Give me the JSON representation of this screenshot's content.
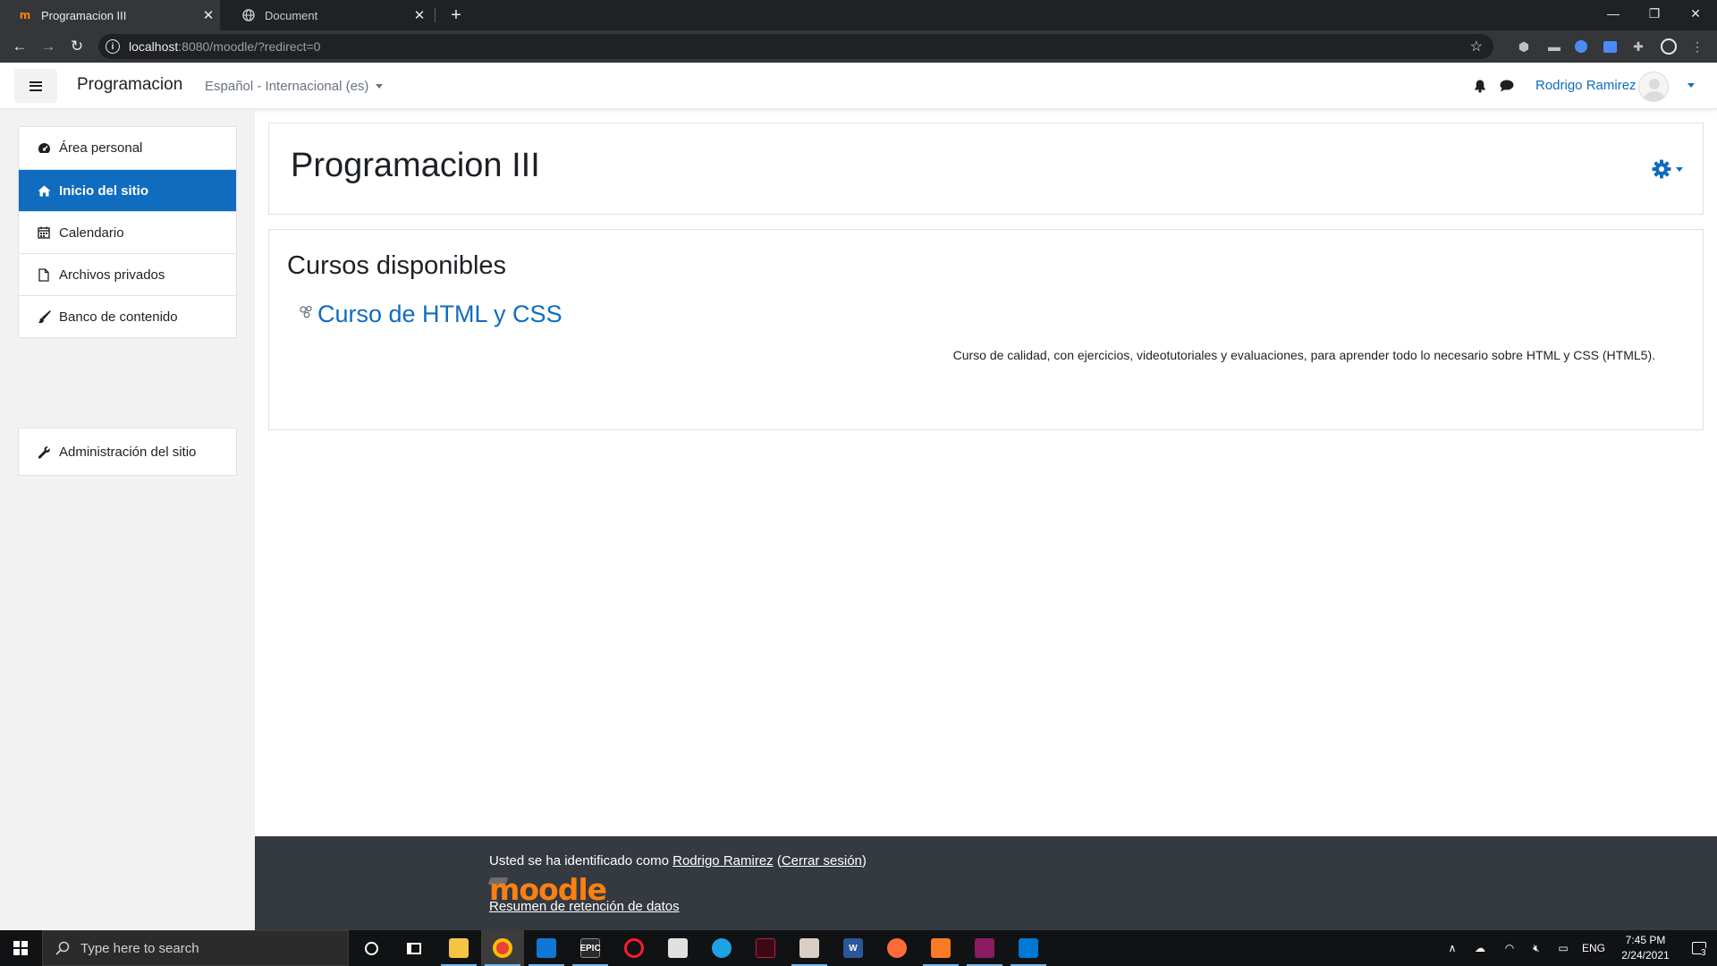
{
  "browser": {
    "tabs": [
      {
        "title": "Programacion III",
        "favicon": "moodle-m-icon"
      },
      {
        "title": "Document",
        "favicon": "globe-icon"
      }
    ],
    "new_tab": "+",
    "url_host": "localhost",
    "url_path": ":8080/moodle/?redirect=0"
  },
  "navbar": {
    "brand": "Programacion",
    "language": "Español - Internacional (es)",
    "user_name": "Rodrigo Ramirez"
  },
  "drawer": {
    "items": [
      {
        "label": "Área personal",
        "icon": "dashboard-icon"
      },
      {
        "label": "Inicio del sitio",
        "icon": "home-icon",
        "active": true
      },
      {
        "label": "Calendario",
        "icon": "calendar-icon"
      },
      {
        "label": "Archivos privados",
        "icon": "file-icon"
      },
      {
        "label": "Banco de contenido",
        "icon": "brush-icon"
      }
    ],
    "admin_item": {
      "label": "Administración del sitio",
      "icon": "wrench-icon"
    }
  },
  "main": {
    "page_title": "Programacion III",
    "section_title": "Cursos disponibles",
    "course": {
      "name": "Curso de HTML y CSS",
      "summary": "Curso de calidad, con ejercicios, videotutoriales y evaluaciones, para aprender todo lo necesario sobre HTML y CSS (HTML5)."
    }
  },
  "footer": {
    "logged_prefix": "Usted se ha identificado como ",
    "logged_user": "Rodrigo Ramirez",
    "logout_open": " (",
    "logout_label": "Cerrar sesión",
    "logout_close": ")",
    "logo_text": "moodle",
    "data_retention": "Resumen de retención de datos"
  },
  "taskbar": {
    "search_placeholder": "Type here to search",
    "language": "ENG",
    "time": "7:45 PM",
    "date": "2/24/2021",
    "notification_count": "3"
  },
  "colors": {
    "primary": "#0f6cbf",
    "moodle_orange": "#f98012",
    "footer_bg": "#343a40",
    "drawer_bg": "#f2f2f2"
  }
}
